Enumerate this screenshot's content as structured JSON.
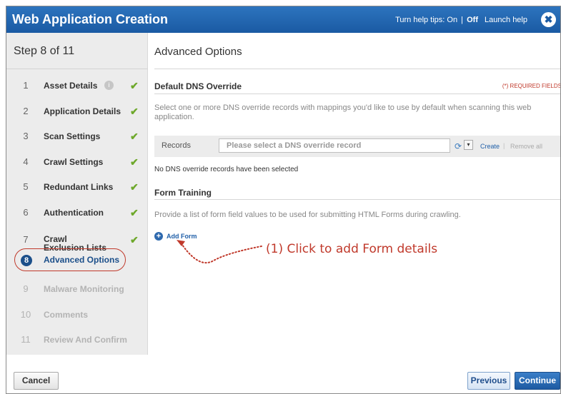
{
  "dialog": {
    "title": "Web Application Creation",
    "help_tips_prefix": "Turn help tips:",
    "help_tips_on": "On",
    "help_tips_sep": "|",
    "help_tips_off": "Off",
    "launch_help": "Launch help",
    "close_icon": "close-icon",
    "close_glyph": "✖"
  },
  "sidebar": {
    "step_title": "Step 8 of 11",
    "steps": [
      {
        "num": "1",
        "label": "Asset Details",
        "complete": true,
        "info_icon": true
      },
      {
        "num": "2",
        "label": "Application Details",
        "complete": true
      },
      {
        "num": "3",
        "label": "Scan Settings",
        "complete": true
      },
      {
        "num": "4",
        "label": "Crawl Settings",
        "complete": true
      },
      {
        "num": "5",
        "label": "Redundant Links",
        "complete": true
      },
      {
        "num": "6",
        "label": "Authentication",
        "complete": true
      },
      {
        "num": "7",
        "label": "Crawl Exclusion Lists",
        "complete": true
      },
      {
        "num": "8",
        "label": "Advanced Options",
        "current": true
      },
      {
        "num": "9",
        "label": "Malware Monitoring",
        "disabled": true
      },
      {
        "num": "10",
        "label": "Comments",
        "disabled": true
      },
      {
        "num": "11",
        "label": "Review And Confirm",
        "disabled": true
      }
    ],
    "check_glyph": "✔",
    "info_glyph": "i"
  },
  "main": {
    "section_title": "Advanced Options",
    "dns": {
      "title": "Default DNS Override",
      "required_note": "(*) REQUIRED FIELDS",
      "description": "Select one or more DNS override records with mappings you'd like to use by default when scanning this web application.",
      "records_label": "Records",
      "records_placeholder": "Please select a DNS override record",
      "create_link": "Create",
      "link_sep": "|",
      "remove_all_link": "Remove all",
      "no_records": "No DNS override records have been selected",
      "refresh_glyph": "⟳",
      "dropdown_glyph": "▾"
    },
    "form_training": {
      "title": "Form Training",
      "description": "Provide a list of form field values to be used for submitting HTML Forms during crawling.",
      "add_form": "Add Form",
      "plus_glyph": "+"
    },
    "annotation": "(1) Click to add Form details"
  },
  "footer": {
    "cancel": "Cancel",
    "previous": "Previous",
    "continue": "Continue"
  },
  "colors": {
    "title_bar": "#1f64ad",
    "annotation_red": "#c0392b",
    "check_green": "#6ea82b",
    "current_step_blue": "#1b4f8a"
  }
}
